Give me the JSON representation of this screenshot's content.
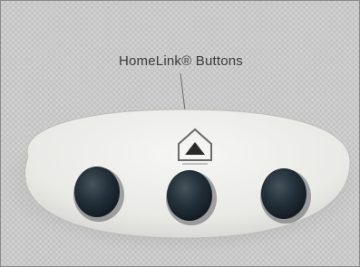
{
  "caption": "HomeLink® Buttons",
  "icons": {
    "homelink": "house-triangle-icon",
    "button_1": "button-icon",
    "button_2": "button-icon",
    "button_3": "button-icon"
  },
  "colors": {
    "headliner": "#c9c9c9",
    "panel": "#ececea",
    "button": "#1f2a2d",
    "caption_text": "#3b3b3b"
  }
}
